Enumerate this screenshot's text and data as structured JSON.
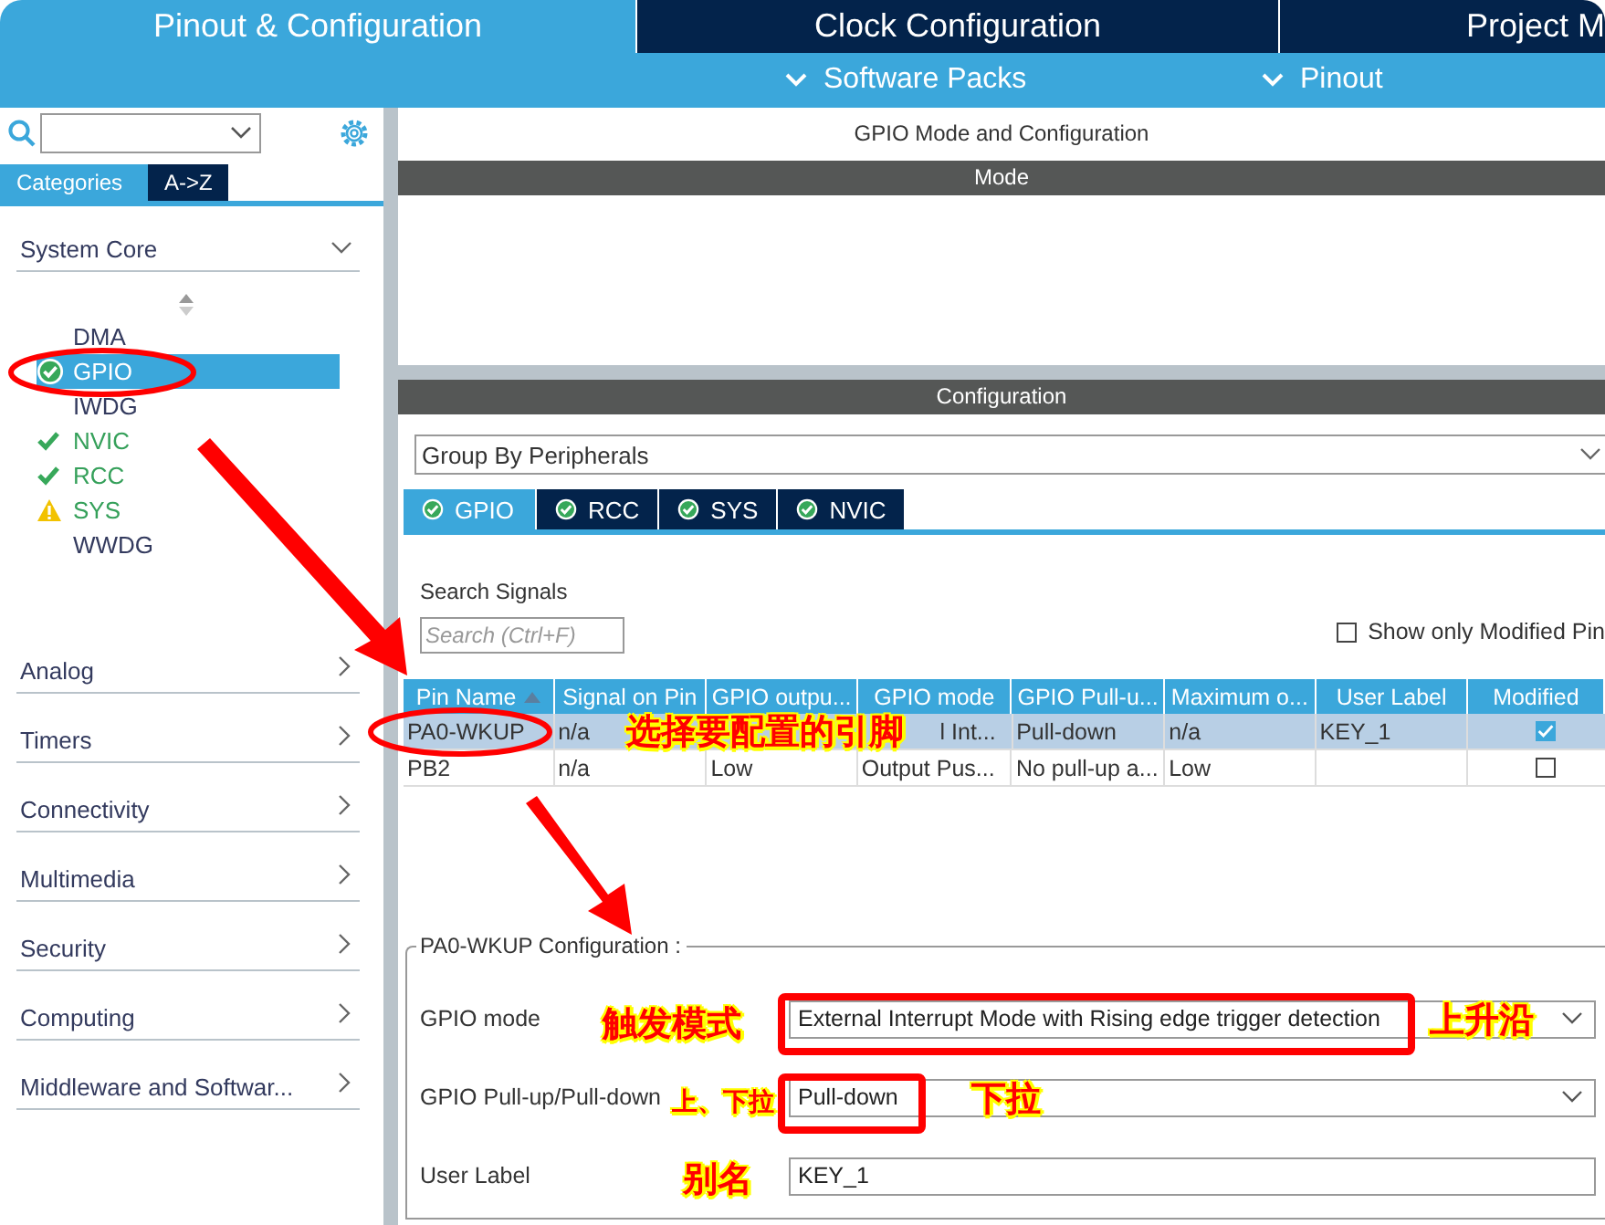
{
  "top_tabs": [
    {
      "label": "Pinout & Configuration",
      "selected": true
    },
    {
      "label": "Clock Configuration",
      "selected": false
    },
    {
      "label": "Project M",
      "selected": false
    }
  ],
  "sub_menu": [
    "Software Packs",
    "Pinout"
  ],
  "sidebar": {
    "tabs": [
      {
        "label": "Categories",
        "selected": true
      },
      {
        "label": "A->Z",
        "selected": false
      }
    ],
    "groups": [
      {
        "label": "System Core",
        "expanded": true,
        "items": [
          {
            "label": "DMA",
            "kind": "plain",
            "selected": false
          },
          {
            "label": "GPIO",
            "kind": "ok",
            "selected": true
          },
          {
            "label": "IWDG",
            "kind": "plain",
            "selected": false
          },
          {
            "label": "NVIC",
            "kind": "ok",
            "selected": false
          },
          {
            "label": "RCC",
            "kind": "ok",
            "selected": false
          },
          {
            "label": "SYS",
            "kind": "warning",
            "selected": false
          },
          {
            "label": "WWDG",
            "kind": "plain",
            "selected": false
          }
        ]
      },
      {
        "label": "Analog",
        "expanded": false
      },
      {
        "label": "Timers",
        "expanded": false
      },
      {
        "label": "Connectivity",
        "expanded": false
      },
      {
        "label": "Multimedia",
        "expanded": false
      },
      {
        "label": "Security",
        "expanded": false
      },
      {
        "label": "Computing",
        "expanded": false
      },
      {
        "label": "Middleware and Softwar...",
        "expanded": false
      }
    ]
  },
  "panel": {
    "title": "GPIO Mode and Configuration",
    "mode_header": "Mode",
    "config_header": "Configuration",
    "group_by": "Group By Peripherals",
    "tabs": [
      {
        "label": "GPIO",
        "selected": true
      },
      {
        "label": "RCC",
        "selected": false
      },
      {
        "label": "SYS",
        "selected": false
      },
      {
        "label": "NVIC",
        "selected": false
      }
    ],
    "search_label": "Search Signals",
    "search_placeholder": "Search (Ctrl+F)",
    "show_modified": {
      "label": "Show only Modified Pin",
      "checked": false
    },
    "table": {
      "columns": [
        "Pin Name",
        "Signal on Pin",
        "GPIO outpu...",
        "GPIO mode",
        "GPIO Pull-u...",
        "Maximum o...",
        "User Label",
        "Modified"
      ],
      "rows": [
        {
          "cells": [
            "PA0-WKUP",
            "n/a",
            "",
            "l Int...",
            "Pull-down",
            "n/a",
            "KEY_1"
          ],
          "modified": true,
          "selected": true
        },
        {
          "cells": [
            "PB2",
            "n/a",
            "Low",
            "Output Pus...",
            "No pull-up a...",
            "Low",
            ""
          ],
          "modified": false,
          "selected": false
        }
      ]
    },
    "config": {
      "legend": "PA0-WKUP Configuration :",
      "fields": [
        {
          "kind": "select",
          "label": "GPIO mode",
          "value": "External Interrupt Mode with Rising edge trigger detection"
        },
        {
          "kind": "select",
          "label": "GPIO Pull-up/Pull-down",
          "value": "Pull-down"
        },
        {
          "kind": "input",
          "label": "User Label",
          "value": "KEY_1"
        }
      ]
    }
  },
  "annotations": {
    "labels": [
      "选择要配置的引脚",
      "触发模式",
      "上升沿",
      "上、下拉",
      "下拉",
      "别名"
    ]
  }
}
